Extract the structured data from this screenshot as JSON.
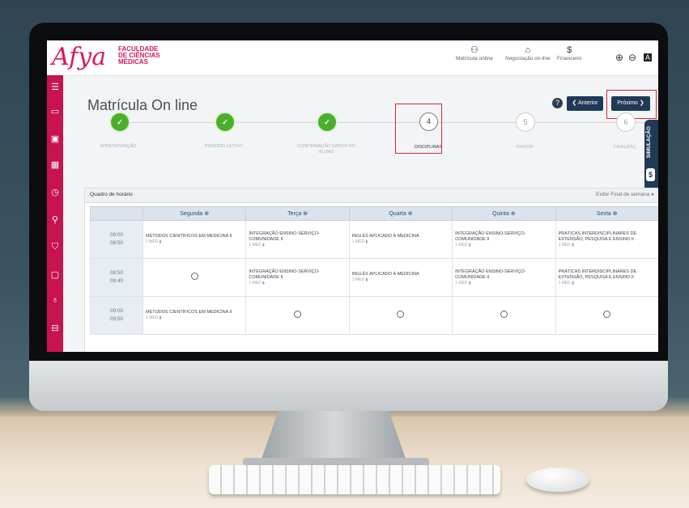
{
  "brand": {
    "logo": "Afya",
    "subtitle": [
      "FACULDADE",
      "DE CIÊNCIAS",
      "MÉDICAS"
    ]
  },
  "topnav": [
    {
      "icon": "user-plus-icon",
      "label": "Matrícula online"
    },
    {
      "icon": "handshake-icon",
      "label": "Negociação on-line"
    },
    {
      "icon": "dollar-icon",
      "label": "Financeiro"
    }
  ],
  "page": {
    "title": "Matrícula On line",
    "prev": "❮ Anterior",
    "next": "Próximo ❯"
  },
  "steps": [
    {
      "num": "✓",
      "label": "APRESENTAÇÃO",
      "state": "done"
    },
    {
      "num": "✓",
      "label": "PERÍODO LETIVO",
      "state": "done"
    },
    {
      "num": "✓",
      "label": "CONFIRMAÇÃO DADOS DO ALUNO",
      "state": "done"
    },
    {
      "num": "4",
      "label": "DISCIPLINAS",
      "state": "current"
    },
    {
      "num": "5",
      "label": "FIADOR",
      "state": "todo"
    },
    {
      "num": "6",
      "label": "FINALIZAÇ",
      "state": "todo"
    }
  ],
  "simulation": {
    "label": "SIMULAÇÃO",
    "icon": "$"
  },
  "schedule": {
    "title": "Quadro de horário",
    "weekend_toggle": "Exibir Final de semana",
    "days": [
      "Segunda",
      "Terça",
      "Quarta",
      "Quinta",
      "Sexta"
    ],
    "rows": [
      {
        "time": [
          "08:00",
          "08:50"
        ],
        "cells": [
          {
            "name": "MÉTODOS CIENTÍFICOS EM MEDICINA II",
            "sub": "1 MED"
          },
          {
            "name": "INTEGRAÇÃO ENSINO-SERVIÇO-COMUNIDADE II",
            "sub": "1 MED"
          },
          {
            "name": "INGLÊS APLICADO À MEDICINA",
            "sub": "1 MED"
          },
          {
            "name": "INTEGRAÇÃO ENSINO-SERVIÇO-COMUNIDADE II",
            "sub": "1 MED"
          },
          {
            "name": "PRÁTICAS INTERDISCIPLINARES DE EXTENSÃO, PESQUISA E ENSINO II",
            "sub": "1 MED"
          }
        ]
      },
      {
        "time": [
          "08:50",
          "09:40"
        ],
        "cells": [
          null,
          {
            "name": "INTEGRAÇÃO ENSINO-SERVIÇO-COMUNIDADE II",
            "sub": "1 MED"
          },
          {
            "name": "INGLÊS APLICADO À MEDICINA",
            "sub": "1 MED"
          },
          {
            "name": "INTEGRAÇÃO ENSINO-SERVIÇO-COMUNIDADE II",
            "sub": "1 MED"
          },
          {
            "name": "PRÁTICAS INTERDISCIPLINARES DE EXTENSÃO, PESQUISA E ENSINO II",
            "sub": "1 MED"
          }
        ]
      },
      {
        "time": [
          "09:00",
          "09:50"
        ],
        "cells": [
          {
            "name": "MÉTODOS CIENTÍFICOS EM MEDICINA II",
            "sub": "1 MED"
          },
          null,
          null,
          null,
          null
        ]
      }
    ]
  },
  "colors": {
    "brand": "#d8175d",
    "sidebar": "#c8134f",
    "button": "#1f3a57",
    "done": "#4caf2c",
    "highlight": "#e0262e"
  }
}
